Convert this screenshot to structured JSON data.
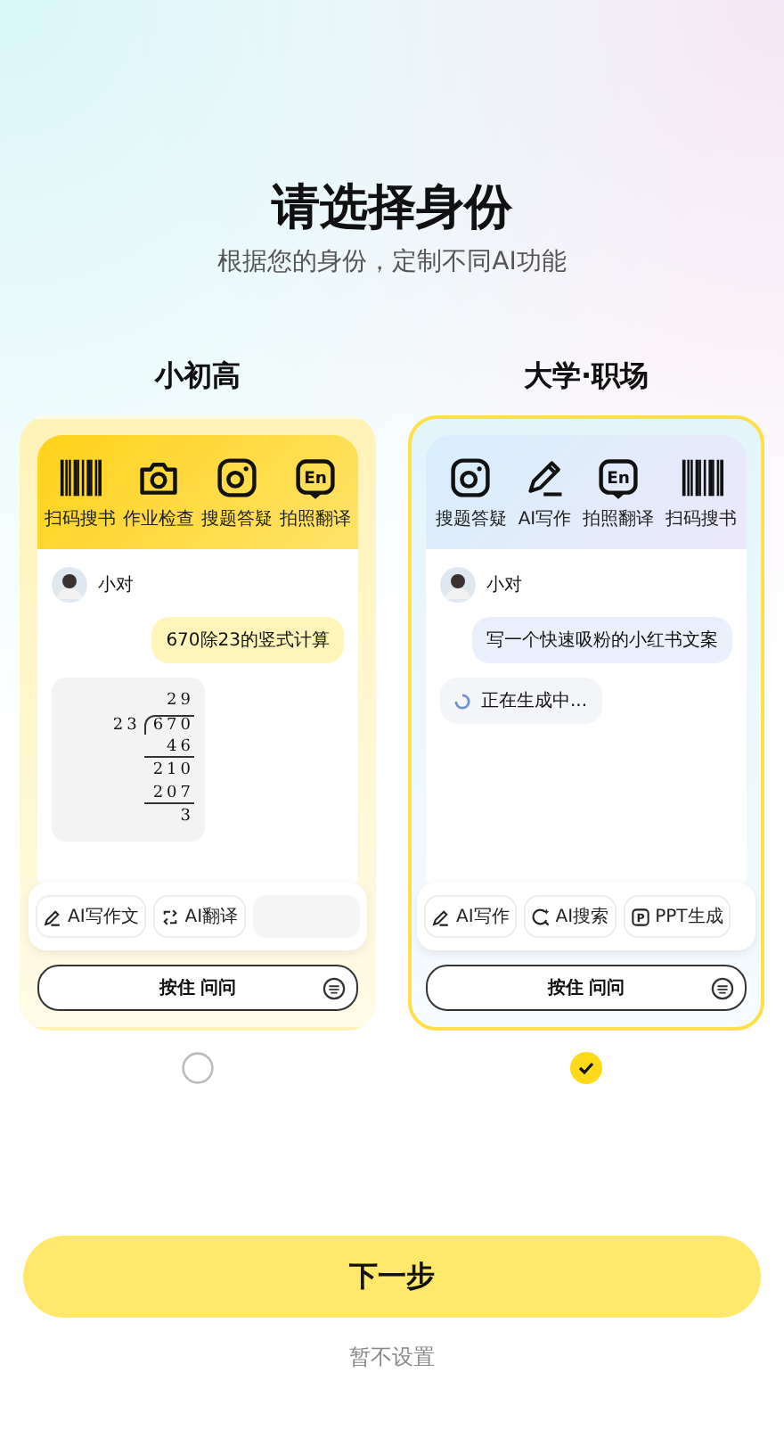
{
  "title": "请选择身份",
  "subtitle": "根据您的身份，定制不同AI功能",
  "options": [
    {
      "label": "小初高",
      "selected": false,
      "tools": [
        {
          "label": "扫码搜书",
          "kind": "barcode"
        },
        {
          "label": "作业检查",
          "kind": "camera"
        },
        {
          "label": "搜题答疑",
          "kind": "lens"
        },
        {
          "label": "拍照翻译",
          "kind": "book",
          "icon_text": "En"
        }
      ],
      "user": "小对",
      "question": "670除23的竖式计算",
      "answer": {
        "kind": "long_division",
        "quotient": "29",
        "divisor": "23",
        "dividend": "670",
        "steps": [
          {
            "text": "46",
            "underline": true
          },
          {
            "text": "210",
            "underline": false
          },
          {
            "text": "207",
            "underline": true
          },
          {
            "text": "3",
            "underline": false
          }
        ]
      },
      "actions": [
        {
          "kind": "pen",
          "label": "AI写作文"
        },
        {
          "kind": "translate",
          "label": "AI翻译"
        },
        {
          "kind": "blank"
        }
      ],
      "voice_button": "按住 问问"
    },
    {
      "label": "大学·职场",
      "selected": true,
      "tools": [
        {
          "label": "搜题答疑",
          "kind": "lens"
        },
        {
          "label": "AI写作",
          "kind": "pencil"
        },
        {
          "label": "拍照翻译",
          "kind": "book",
          "icon_text": "En"
        },
        {
          "label": "扫码搜书",
          "kind": "barcode"
        }
      ],
      "user": "小对",
      "question": "写一个快速吸粉的小红书文案",
      "answer": {
        "kind": "loading",
        "text": "正在生成中..."
      },
      "actions": [
        {
          "kind": "pen",
          "label": "AI写作"
        },
        {
          "kind": "search",
          "label": "AI搜索"
        },
        {
          "kind": "ppt",
          "label": "PPT生成",
          "icon_text": "P"
        }
      ],
      "voice_button": "按住 问问"
    }
  ],
  "next_button": "下一步",
  "skip_link": "暂不设置"
}
